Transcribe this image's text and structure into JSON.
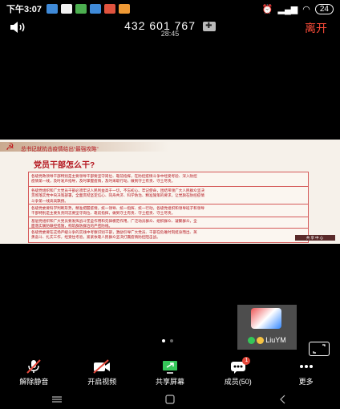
{
  "status_bar": {
    "time": "下午3:07",
    "battery": "24"
  },
  "meeting": {
    "id": "432 601 767",
    "duration": "28:45",
    "leave_label": "离开"
  },
  "slide": {
    "subtitle": "总书记就抗击疫情给出“最强攻略”",
    "title": "党员干部怎么干?",
    "blocks": [
      [
        "各级党政领导干部特别是主要领导干部要坚守岗位、靠前指挥，在防控疫情斗争中经受考验、深入防控",
        "疫情第一线，及时发声指导，及时掌握疫情，及时采取行动，做到守土有责、守土尽责。"
      ],
      [
        "各级党组织和广大党员干部必须牢记人民利益高于一切，不忘初心、牢记使命，团结带领广大人民群众坚决",
        "贯彻落实党中央决策部署，全面贯彻坚定信心、同舟共济、科学防治、精准施策的要求，让党旗在防控疫情",
        "斗争第一线高高飘扬。"
      ],
      [
        "各级党委要科学判断形势，精准把握疫情，统一领导、统一指挥、统一行动，各级党组织和领导班子和领导",
        "干部特别是主要负责同志要坚守岗位、靠前指挥，做到守土有责、守土担责、守土尽责。"
      ],
      [
        "基层党组织和广大党员要发挥战斗堡垒作用和先锋模范作用，广泛动员群众、组织群众、凝聚群众，全",
        "面落实联防联控措施，构筑群防群治的严密防线。"
      ],
      [
        "各级党委要在这场严峻斗争的实践中考察识别干部，激励引导广大党员、干部在危难时刻挺身而出、英",
        "勇奋斗、扎实工作，经受住考验，紧紧依靠人民群众坚决打赢疫情防控阻击战。"
      ]
    ],
    "footer": "共享中心"
  },
  "participant": {
    "name": "LiuYM"
  },
  "toolbar": {
    "items": [
      {
        "label": "解除静音",
        "icon": "muted-mic-icon"
      },
      {
        "label": "开启视频",
        "icon": "video-off-icon"
      },
      {
        "label": "共享屏幕",
        "icon": "share-screen-icon"
      },
      {
        "label": "成员(50)",
        "icon": "members-icon",
        "badge": "1"
      },
      {
        "label": "更多",
        "icon": "more-icon"
      }
    ]
  },
  "colors": {
    "background": "#000000",
    "leave": "#ff4d3a",
    "slide_red": "#b3121b",
    "slide_bg": "#f6f1ea"
  }
}
